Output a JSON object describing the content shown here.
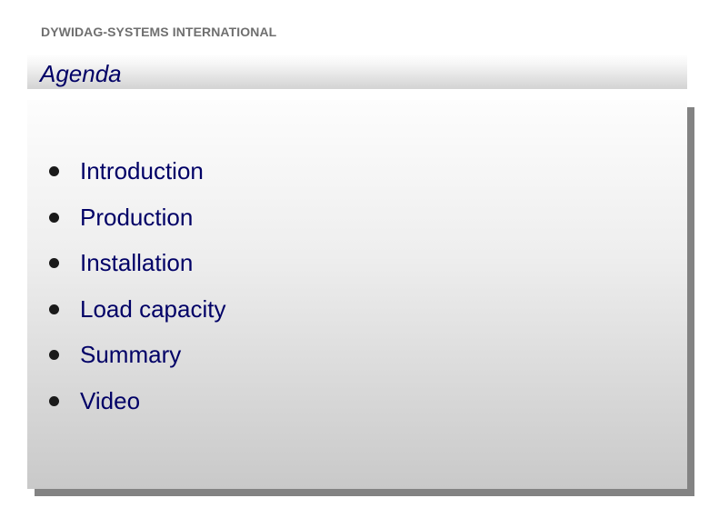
{
  "header": {
    "company": "DYWIDAG-SYSTEMS INTERNATIONAL"
  },
  "slide": {
    "title": "Agenda",
    "items": [
      {
        "label": "Introduction",
        "icon": "bullet-icon"
      },
      {
        "label": "Production",
        "icon": "bullet-icon"
      },
      {
        "label": "Installation",
        "icon": "bullet-icon"
      },
      {
        "label": "Load capacity",
        "icon": "bullet-icon"
      },
      {
        "label": "Summary",
        "icon": "bullet-icon"
      },
      {
        "label": "Video",
        "icon": "bullet-icon"
      }
    ]
  },
  "colors": {
    "title_text": "#000066",
    "company_text": "#6f6f6f",
    "bullet": "#1a1a1a"
  }
}
